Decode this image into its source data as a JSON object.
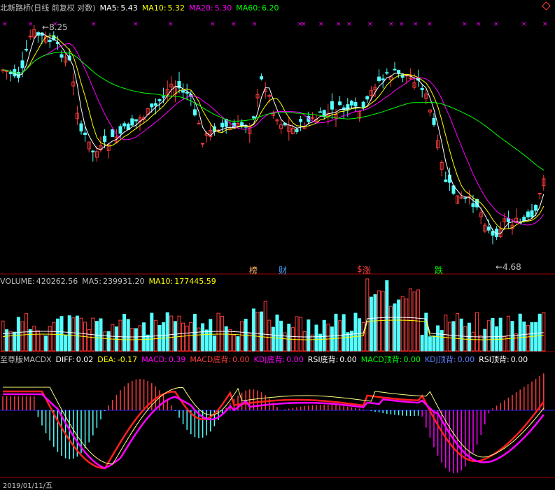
{
  "colors": {
    "up": "#ff3c3c",
    "down": "#54ffff",
    "ma5": "#ffffff",
    "ma10": "#ffff00",
    "ma20": "#ff00ff",
    "ma60": "#00ff00",
    "axis": "#3030a0"
  },
  "header": {
    "title": "北新路桥(日线 前复权 对数)",
    "ma5_label": "MA5:",
    "ma5_value": "5.43",
    "ma10_label": "MA10:",
    "ma10_value": "5.32",
    "ma20_label": "MA20:",
    "ma20_value": "5.30",
    "ma60_label": "MA60:",
    "ma60_value": "6.20"
  },
  "price_chart": {
    "high_label": "8.25",
    "low_label": "4.68",
    "markers": [
      "榜",
      "财",
      "$",
      "涨",
      "跌"
    ]
  },
  "volume": {
    "label": "VOLUME:",
    "value": "420262.56",
    "ma5_label": "MA5:",
    "ma5_value": "239931.20",
    "ma10_label": "MA10:",
    "ma10_value": "177445.59"
  },
  "indicator": {
    "name": "至尊版MACDX",
    "diff_label": "DIFF:",
    "diff_value": "0.02",
    "dea_label": "DEA:",
    "dea_value": "-0.17",
    "macd_label": "MACD:",
    "macd_value": "0.39",
    "macd_bottom_label": "MACD底背:",
    "macd_bottom_value": "0.00",
    "kdj_bottom_label": "KDJ底背:",
    "kdj_bottom_value": "0.00",
    "rsi_bottom_label": "RSI底背:",
    "rsi_bottom_value": "0.00",
    "macd_top_label": "MACD顶背:",
    "macd_top_value": "0.00",
    "kdj_top_label": "KDJ顶背:",
    "kdj_top_value": "0.00",
    "rsi_top_label": "RSI顶背:",
    "rsi_top_value": "0.00"
  },
  "footer": {
    "date": "2019/01/11/五"
  }
}
